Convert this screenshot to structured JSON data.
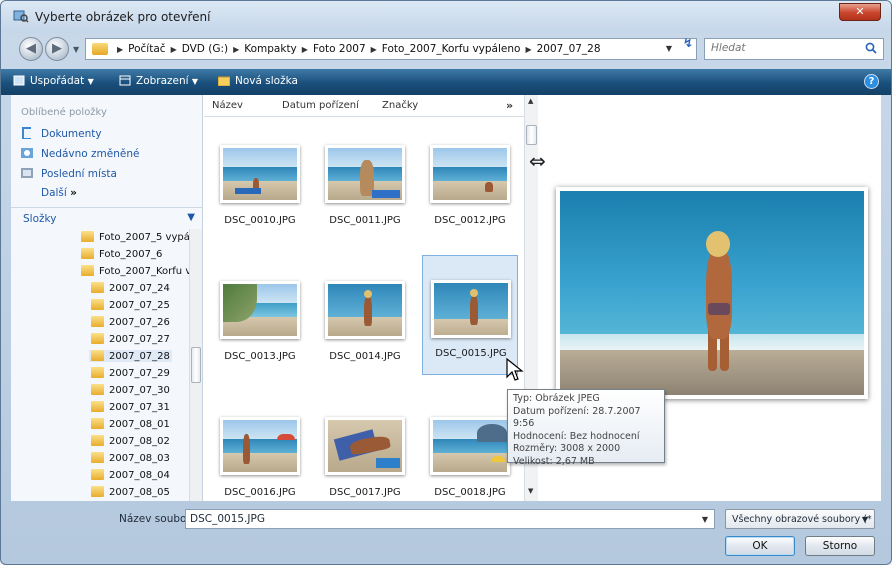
{
  "window": {
    "title": "Vyberte obrázek pro otevření",
    "close_label": "✕"
  },
  "address": {
    "crumbs": [
      "Počítač",
      "DVD (G:)",
      "Kompakty",
      "Foto 2007",
      "Foto_2007_Korfu vypáleno",
      "2007_07_28"
    ]
  },
  "search": {
    "placeholder": "Hledat"
  },
  "toolbar": {
    "organize": "Uspořádat",
    "views": "Zobrazení",
    "new_folder": "Nová složka"
  },
  "sidebar": {
    "favorites_heading": "Oblíbené položky",
    "favorites": [
      "Dokumenty",
      "Nedávno změněné",
      "Poslední místa"
    ],
    "more": "Další",
    "more_arrows": "»",
    "folders_heading": "Složky",
    "tree": [
      "Foto_2007_5 vypá",
      "Foto_2007_6",
      "Foto_2007_Korfu v",
      "2007_07_24",
      "2007_07_25",
      "2007_07_26",
      "2007_07_27",
      "2007_07_28",
      "2007_07_29",
      "2007_07_30",
      "2007_07_31",
      "2007_08_01",
      "2007_08_02",
      "2007_08_03",
      "2007_08_04",
      "2007_08_05"
    ],
    "tree_selected": "2007_07_28"
  },
  "columns": {
    "name": "Název",
    "date": "Datum pořízení",
    "tags": "Značky",
    "more": "»"
  },
  "files": [
    "DSC_0010.JPG",
    "DSC_0011.JPG",
    "DSC_0012.JPG",
    "DSC_0013.JPG",
    "DSC_0014.JPG",
    "DSC_0015.JPG",
    "DSC_0016.JPG",
    "DSC_0017.JPG",
    "DSC_0018.JPG"
  ],
  "selected_file": "DSC_0015.JPG",
  "tooltip": {
    "type": "Typ: Obrázek JPEG",
    "date": "Datum pořízení: 28.7.2007 9:56",
    "rating": "Hodnocení: Bez hodnocení",
    "dimensions": "Rozměry: 3008 x 2000",
    "size": "Velikost: 2,67 MB"
  },
  "bottom": {
    "filename_label": "Název souboru:",
    "filename_value": "DSC_0015.JPG",
    "filter": "Všechny obrazové soubory (*",
    "ok": "OK",
    "cancel": "Storno"
  },
  "colors": {
    "toolbar": "#1a4f7c",
    "link": "#1f58a8",
    "selection": "#dbe9f7"
  }
}
